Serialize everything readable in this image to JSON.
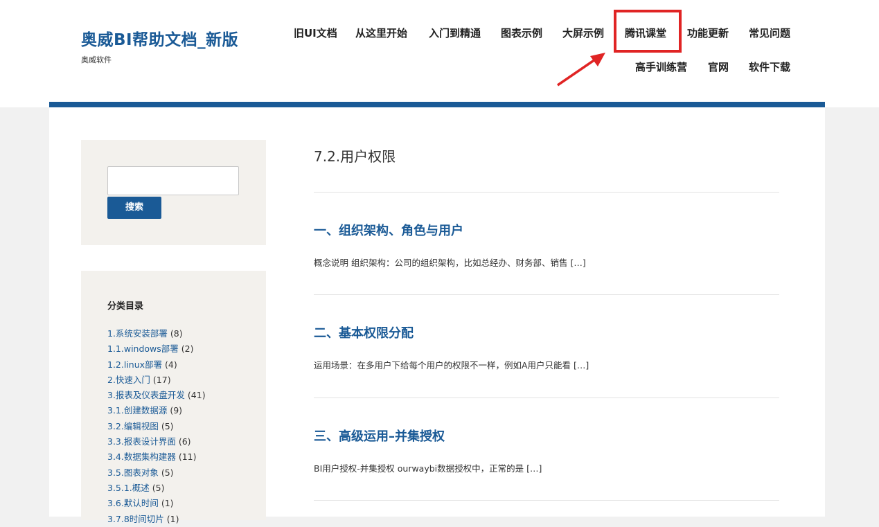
{
  "site": {
    "title": "奥威BI帮助文档_新版",
    "subtitle": "奥威软件"
  },
  "nav": {
    "items": [
      {
        "label": "旧UI文档"
      },
      {
        "label": "从这里开始"
      },
      {
        "label": "入门到精通"
      },
      {
        "label": "图表示例"
      },
      {
        "label": "大屏示例"
      },
      {
        "label": "腾讯课堂"
      },
      {
        "label": "功能更新"
      },
      {
        "label": "常见问题"
      },
      {
        "label": "高手训练营"
      },
      {
        "label": "官网"
      },
      {
        "label": "软件下载"
      }
    ],
    "highlighted": "腾讯课堂"
  },
  "colors": {
    "brand": "#1a5a96",
    "highlight": "#e02424",
    "widget_bg": "#f3f1ed"
  },
  "search": {
    "value": "",
    "button_label": "搜索"
  },
  "categories": {
    "title": "分类目录",
    "items": [
      {
        "name": "1.系统安装部署",
        "count": "(8)"
      },
      {
        "name": "1.1.windows部署",
        "count": "(2)"
      },
      {
        "name": "1.2.linux部署",
        "count": "(4)"
      },
      {
        "name": "2.快速入门",
        "count": "(17)"
      },
      {
        "name": "3.报表及仪表盘开发",
        "count": "(41)"
      },
      {
        "name": "3.1.创建数据源",
        "count": "(9)"
      },
      {
        "name": "3.2.编辑视图",
        "count": "(5)"
      },
      {
        "name": "3.3.报表设计界面",
        "count": "(6)"
      },
      {
        "name": "3.4.数据集构建器",
        "count": "(11)"
      },
      {
        "name": "3.5.图表对象",
        "count": "(5)"
      },
      {
        "name": "3.5.1.概述",
        "count": "(5)"
      },
      {
        "name": "3.6.默认时间",
        "count": "(1)"
      },
      {
        "name": "3.7.8时间切片",
        "count": "(1)"
      }
    ]
  },
  "page": {
    "title": "7.2.用户权限"
  },
  "posts": [
    {
      "title": "一、组织架构、角色与用户",
      "excerpt": "概念说明 组织架构：公司的组织架构，比如总经办、财务部、销售 […]"
    },
    {
      "title": "二、基本权限分配",
      "excerpt": "运用场景：在多用户下给每个用户的权限不一样，例如A用户只能看 […]"
    },
    {
      "title": "三、高级运用–并集授权",
      "excerpt": "BI用户授权-并集授权 ourwaybi数据授权中，正常的是 […]"
    }
  ]
}
